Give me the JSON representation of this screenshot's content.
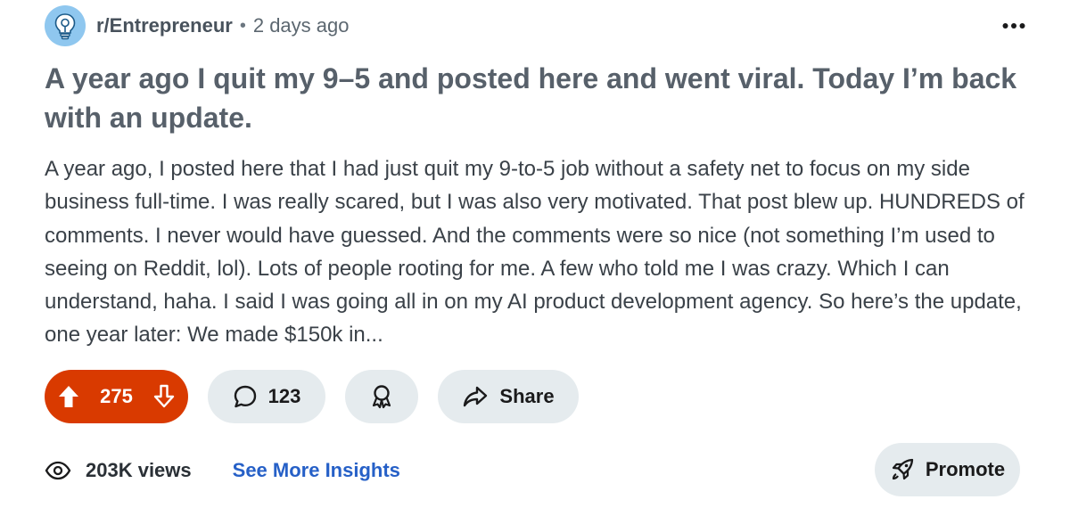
{
  "header": {
    "subreddit": "r/Entrepreneur",
    "separator": "•",
    "time": "2 days ago",
    "avatar_icon": "lightbulb-icon",
    "more_icon": "more-options-icon"
  },
  "post": {
    "title": "A year ago I quit my 9–5 and posted here and went viral. Today I’m back with an update.",
    "body": "A year ago, I posted here that I had just quit my 9-to-5 job without a safety net to focus on my side business full-time. I was really scared, but I was also very motivated. That post blew up. HUNDREDS of comments. I never would have guessed. And the comments were so nice (not something I’m used to seeing on Reddit, lol). Lots of people rooting for me. A few who told me I was crazy. Which I can understand, haha. I said I was going all in on my AI product development agency. So here’s the update, one year later: We made $150k in..."
  },
  "actions": {
    "vote_count": "275",
    "comment_count": "123",
    "share_label": "Share",
    "upvote_icon": "upvote-arrow-icon",
    "downvote_icon": "downvote-arrow-icon",
    "comment_icon": "comment-bubble-icon",
    "award_icon": "award-icon",
    "share_icon": "share-arrow-icon"
  },
  "footer": {
    "views": "203K views",
    "insights_label": "See More Insights",
    "promote_label": "Promote",
    "views_icon": "eye-icon",
    "promote_icon": "rocket-icon"
  },
  "colors": {
    "vote_active": "#d93a00",
    "pill_bg": "#e5ebee",
    "link": "#2660c7",
    "avatar_bg": "#8fc7ef"
  }
}
